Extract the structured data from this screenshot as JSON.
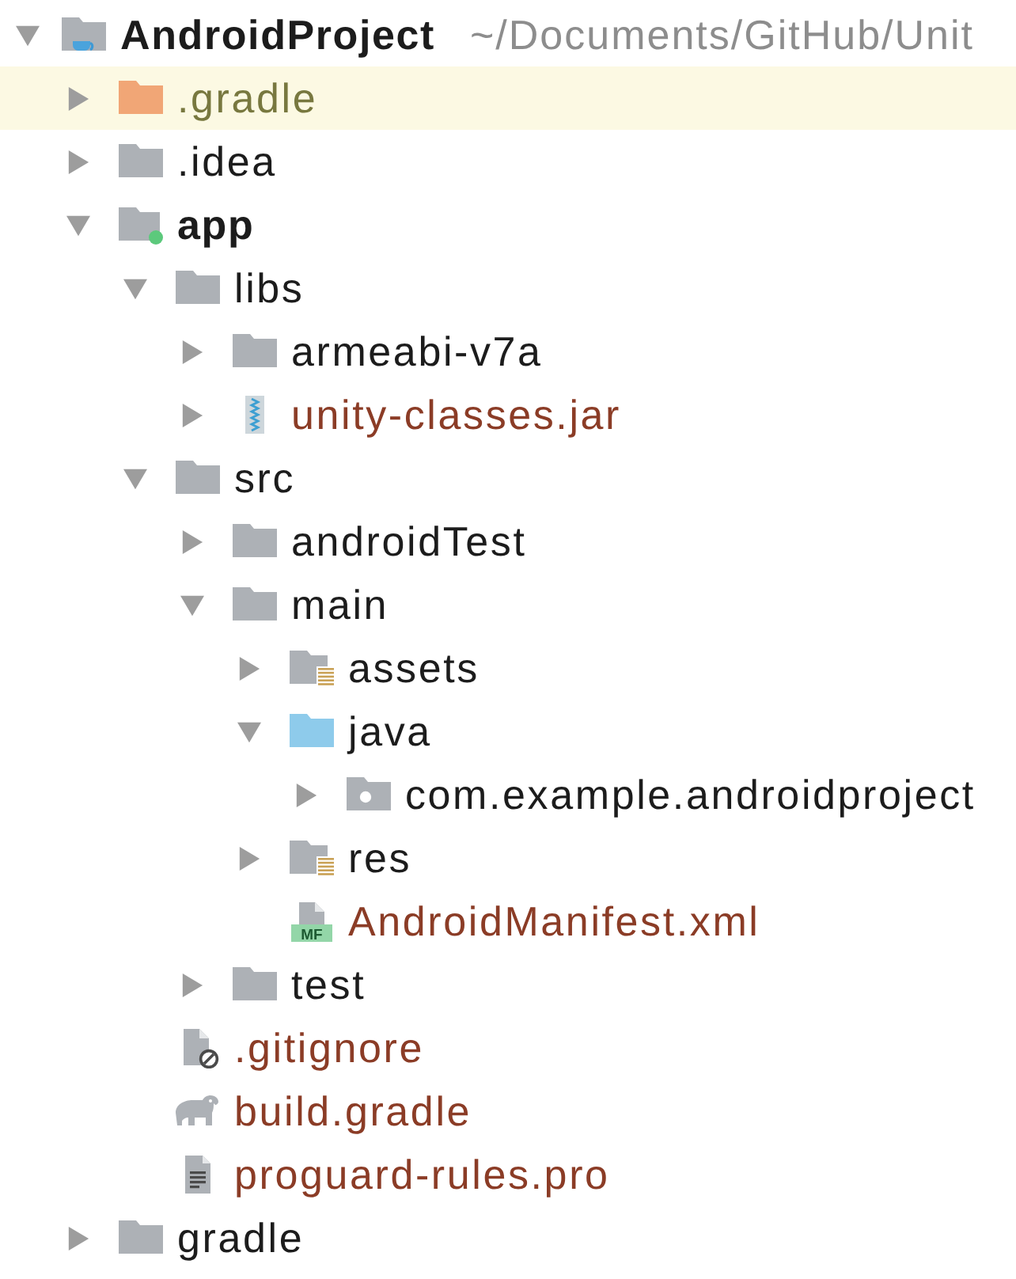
{
  "project_tree": {
    "items": [
      {
        "label": "AndroidProject",
        "kind": "project",
        "path": "~/Documents/GitHub/Unit",
        "expanded": true,
        "highlighted": false,
        "ignored": false,
        "unversioned": false,
        "children": [
          {
            "label": ".gradle",
            "kind": "excluded_folder",
            "expanded": false,
            "highlighted": true,
            "ignored": true,
            "unversioned": false
          },
          {
            "label": ".idea",
            "kind": "folder",
            "expanded": false,
            "highlighted": false,
            "ignored": false,
            "unversioned": false
          },
          {
            "label": "app",
            "kind": "module",
            "expanded": true,
            "highlighted": false,
            "ignored": false,
            "unversioned": false,
            "children": [
              {
                "label": "libs",
                "kind": "folder",
                "expanded": true,
                "highlighted": false,
                "ignored": false,
                "unversioned": false,
                "children": [
                  {
                    "label": "armeabi-v7a",
                    "kind": "folder",
                    "expanded": false,
                    "highlighted": false,
                    "ignored": false,
                    "unversioned": false
                  },
                  {
                    "label": "unity-classes.jar",
                    "kind": "jar",
                    "expanded": false,
                    "highlighted": false,
                    "ignored": false,
                    "unversioned": true
                  }
                ]
              },
              {
                "label": "src",
                "kind": "folder",
                "expanded": true,
                "highlighted": false,
                "ignored": false,
                "unversioned": false,
                "children": [
                  {
                    "label": "androidTest",
                    "kind": "folder",
                    "expanded": false,
                    "highlighted": false,
                    "ignored": false,
                    "unversioned": false
                  },
                  {
                    "label": "main",
                    "kind": "folder",
                    "expanded": true,
                    "highlighted": false,
                    "ignored": false,
                    "unversioned": false,
                    "children": [
                      {
                        "label": "assets",
                        "kind": "resource_folder",
                        "expanded": false,
                        "highlighted": false,
                        "ignored": false,
                        "unversioned": false
                      },
                      {
                        "label": "java",
                        "kind": "source_folder",
                        "expanded": true,
                        "highlighted": false,
                        "ignored": false,
                        "unversioned": false,
                        "children": [
                          {
                            "label": "com.example.androidproject",
                            "kind": "package",
                            "expanded": false,
                            "highlighted": false,
                            "ignored": false,
                            "unversioned": false
                          }
                        ]
                      },
                      {
                        "label": "res",
                        "kind": "resource_folder",
                        "expanded": false,
                        "highlighted": false,
                        "ignored": false,
                        "unversioned": false
                      },
                      {
                        "label": "AndroidManifest.xml",
                        "kind": "manifest",
                        "icon_label": "MF",
                        "highlighted": false,
                        "ignored": false,
                        "unversioned": true
                      }
                    ]
                  },
                  {
                    "label": "test",
                    "kind": "folder",
                    "expanded": false,
                    "highlighted": false,
                    "ignored": false,
                    "unversioned": false
                  }
                ]
              },
              {
                "label": ".gitignore",
                "kind": "ignore_file",
                "highlighted": false,
                "ignored": false,
                "unversioned": true
              },
              {
                "label": "build.gradle",
                "kind": "gradle_file",
                "highlighted": false,
                "ignored": false,
                "unversioned": true
              },
              {
                "label": "proguard-rules.pro",
                "kind": "text_file",
                "highlighted": false,
                "ignored": false,
                "unversioned": true
              }
            ]
          },
          {
            "label": "gradle",
            "kind": "folder",
            "expanded": false,
            "highlighted": false,
            "ignored": false,
            "unversioned": false
          }
        ]
      }
    ]
  }
}
